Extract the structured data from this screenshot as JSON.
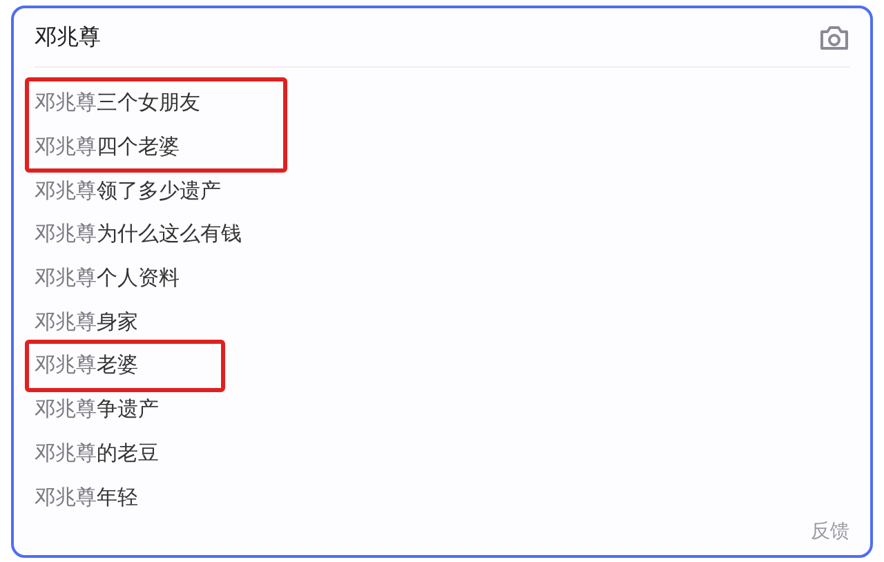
{
  "search": {
    "value": "邓兆尊"
  },
  "suggestion_groups": [
    {
      "outlined": true,
      "items": [
        {
          "query": "邓兆尊",
          "suffix": "三个女朋友"
        },
        {
          "query": "邓兆尊",
          "suffix": "四个老婆"
        }
      ]
    },
    {
      "outlined": false,
      "items": [
        {
          "query": "邓兆尊",
          "suffix": "领了多少遗产"
        },
        {
          "query": "邓兆尊",
          "suffix": "为什么这么有钱"
        },
        {
          "query": "邓兆尊",
          "suffix": "个人资料"
        },
        {
          "query": "邓兆尊",
          "suffix": "身家"
        }
      ]
    },
    {
      "outlined": true,
      "items": [
        {
          "query": "邓兆尊",
          "suffix": "老婆"
        }
      ]
    },
    {
      "outlined": false,
      "items": [
        {
          "query": "邓兆尊",
          "suffix": "争遗产"
        },
        {
          "query": "邓兆尊",
          "suffix": "的老豆"
        },
        {
          "query": "邓兆尊",
          "suffix": "年轻"
        }
      ]
    }
  ],
  "feedback": "反馈"
}
